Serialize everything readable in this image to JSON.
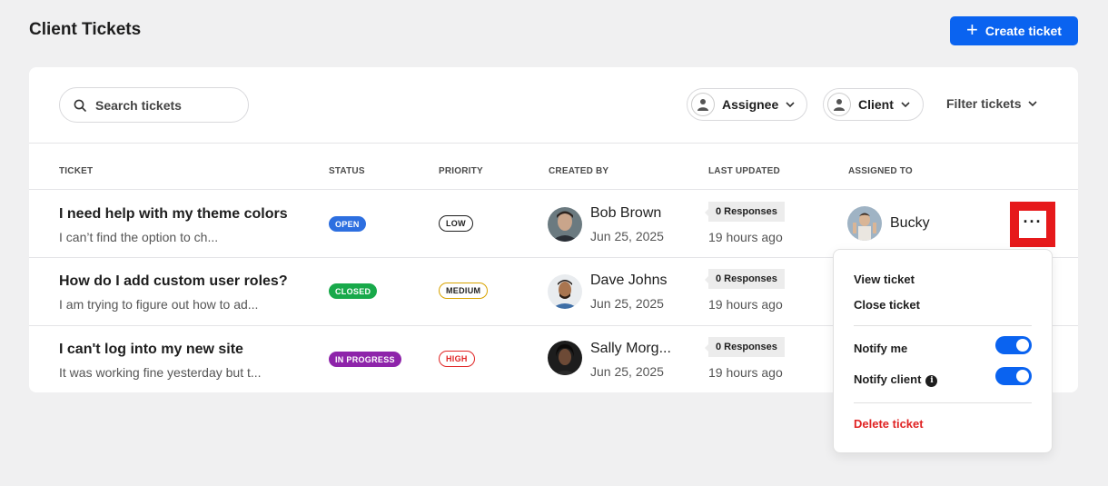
{
  "header": {
    "title": "Client Tickets",
    "create_label": "Create ticket"
  },
  "toolbar": {
    "search_placeholder": "Search tickets",
    "assignee_label": "Assignee",
    "client_label": "Client",
    "filter_label": "Filter tickets"
  },
  "columns": {
    "ticket": "TICKET",
    "status": "STATUS",
    "priority": "PRIORITY",
    "created_by": "CREATED BY",
    "last_updated": "LAST UPDATED",
    "assigned_to": "ASSIGNED TO"
  },
  "rows": [
    {
      "title": "I need help with my theme colors",
      "desc": "I can’t find the option to ch...",
      "status": "OPEN",
      "priority": "LOW",
      "creator": "Bob Brown",
      "created_date": "Jun 25, 2025",
      "responses": "0 Responses",
      "updated": "19 hours ago",
      "assignee": "Bucky"
    },
    {
      "title": "How do I add custom user roles?",
      "desc": "I am trying to figure out how to ad...",
      "status": "CLOSED",
      "priority": "MEDIUM",
      "creator": "Dave Johns",
      "created_date": "Jun 25, 2025",
      "responses": "0 Responses",
      "updated": "19 hours ago",
      "assignee": ""
    },
    {
      "title": "I can't log into my new site",
      "desc": "It was working fine yesterday but t...",
      "status": "IN PROGRESS",
      "priority": "HIGH",
      "creator": "Sally Morg...",
      "created_date": "Jun 25, 2025",
      "responses": "0 Responses",
      "updated": "19 hours ago",
      "assignee": ""
    }
  ],
  "menu": {
    "view": "View ticket",
    "close": "Close ticket",
    "notify_me": "Notify me",
    "notify_client": "Notify client",
    "delete": "Delete ticket",
    "notify_me_on": true,
    "notify_client_on": true
  },
  "colors": {
    "accent": "#0a63f0",
    "status_open": "#2d6fe0",
    "status_closed": "#18a94a",
    "status_in_progress": "#8e24aa",
    "priority_low": "#1e1e1e",
    "priority_medium": "#d8a300",
    "priority_high": "#e02424",
    "delete": "#e02424",
    "highlight": "#e6191b"
  },
  "icons": {
    "search": "search-icon",
    "user": "user-icon",
    "chevron": "chevron-down-icon",
    "more": "more-horizontal-icon",
    "info": "info-icon"
  }
}
